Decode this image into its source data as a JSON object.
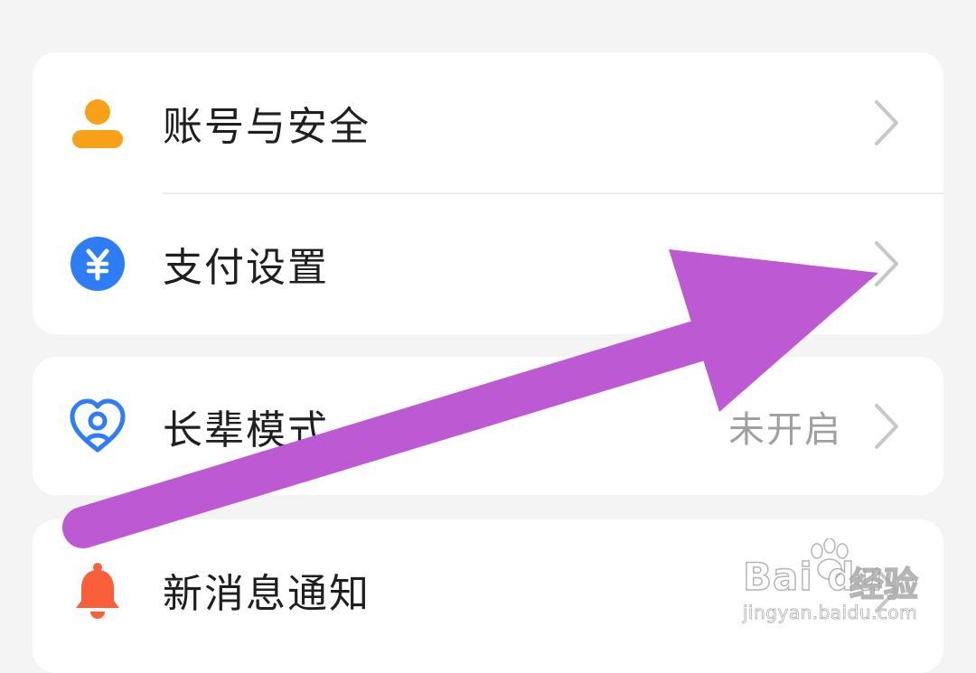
{
  "settings": {
    "account": {
      "label": "账号与安全",
      "icon": "person-icon"
    },
    "payment": {
      "label": "支付设置",
      "icon": "yuan-icon"
    },
    "elder_mode": {
      "label": "长辈模式",
      "value": "未开启",
      "icon": "heart-icon"
    },
    "notifications": {
      "label": "新消息通知",
      "icon": "bell-icon"
    }
  },
  "watermark": {
    "brand": "Bai du",
    "product": "经验",
    "url": "jingyan.baidu.com"
  },
  "colors": {
    "account_icon": "#f7a118",
    "payment_icon": "#2e7cf6",
    "elder_icon": "#2e7cf6",
    "bell_icon": "#f9603a",
    "annotation_arrow": "#bd5ad3"
  }
}
